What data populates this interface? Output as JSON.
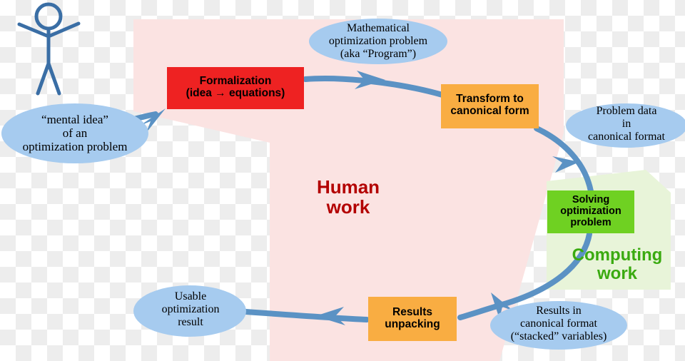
{
  "diagram": {
    "title": "Optimization workflow: human work vs computing work",
    "zones": [
      {
        "id": "human",
        "label": "Human\nwork",
        "color": "#fbe3e2"
      },
      {
        "id": "computing",
        "label": "Computing\nwork",
        "color": "#e8f4d9"
      }
    ],
    "actor": {
      "name": "stick-figure",
      "color": "#3a6ea5"
    },
    "palette": {
      "ellipse_fill": "#a6cbef",
      "arrow": "#5b92c4",
      "red_box": "#ee2222",
      "orange_box": "#f9ad42",
      "green_box": "#6fd122",
      "human_zone": "#fbe3e2",
      "computing_zone": "#e8f4d9",
      "human_text": "#b30000",
      "computing_text": "#3aaa10",
      "actor": "#3a6ea5"
    },
    "states": [
      {
        "id": "mental-idea",
        "label": "“mental idea”\nof an\noptimization problem",
        "shape": "ellipse"
      },
      {
        "id": "math-optimization-problem",
        "label": "Mathematical\noptimization problem\n(aka “Program”)",
        "shape": "ellipse"
      },
      {
        "id": "problem-data-canonical",
        "label": "Problem data\nin\ncanonical format",
        "shape": "ellipse"
      },
      {
        "id": "results-canonical",
        "label": "Results in\ncanonical format\n(“stacked” variables)",
        "shape": "ellipse"
      },
      {
        "id": "usable-result",
        "label": "Usable\noptimization\nresult",
        "shape": "ellipse"
      }
    ],
    "processes": [
      {
        "id": "formalization",
        "label": "Formalization\n(idea → equations)",
        "color": "#ee2222",
        "zone": "human"
      },
      {
        "id": "transform-canonical",
        "label": "Transform to\ncanonical form",
        "color": "#f9ad42",
        "zone": "human"
      },
      {
        "id": "solving",
        "label": "Solving\noptimization\nproblem",
        "color": "#6fd122",
        "zone": "computing"
      },
      {
        "id": "results-unpacking",
        "label": "Results\nunpacking",
        "color": "#f9ad42",
        "zone": "human"
      }
    ],
    "flow": [
      {
        "from": "mental-idea",
        "to": "formalization"
      },
      {
        "from": "formalization",
        "to": "transform-canonical"
      },
      {
        "from": "transform-canonical",
        "to": "solving"
      },
      {
        "from": "solving",
        "to": "results-unpacking"
      },
      {
        "from": "results-unpacking",
        "to": "usable-result"
      }
    ]
  }
}
